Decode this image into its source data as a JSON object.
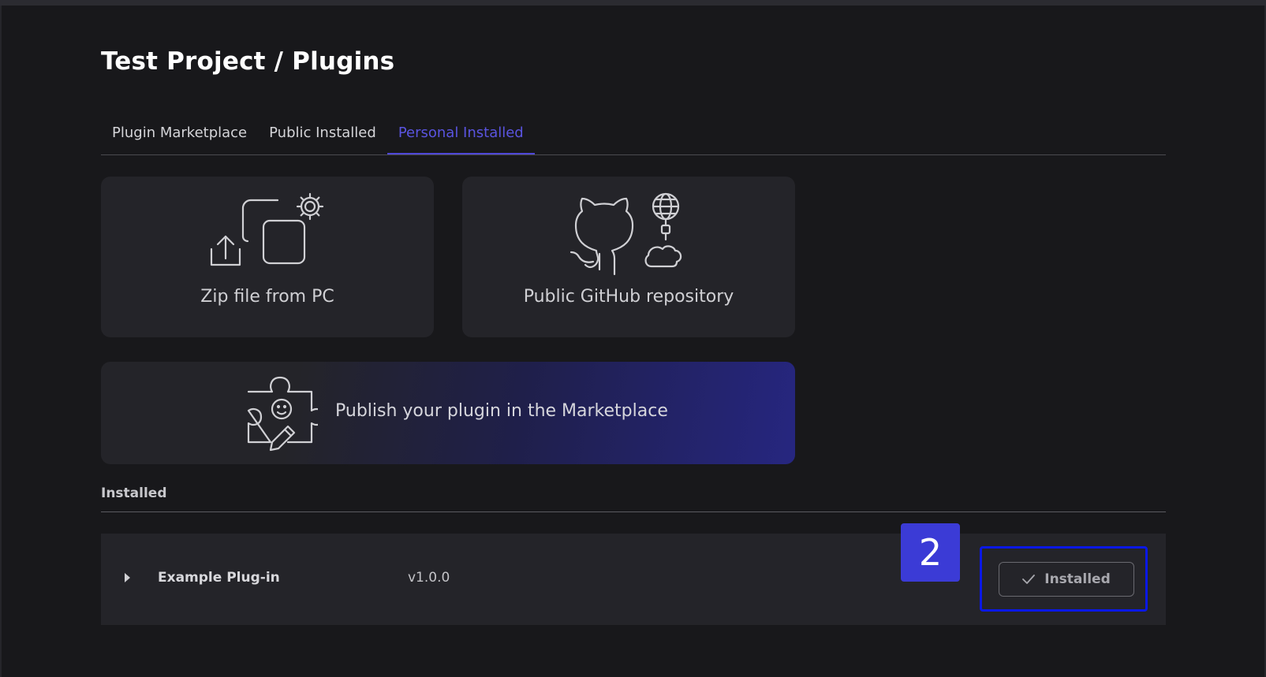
{
  "page": {
    "title": "Test Project / Plugins"
  },
  "tabs": [
    {
      "label": "Plugin Marketplace",
      "active": false
    },
    {
      "label": "Public Installed",
      "active": false
    },
    {
      "label": "Personal Installed",
      "active": true
    }
  ],
  "sources": [
    {
      "label": "Zip file from PC",
      "icon": "upload-zip-icon"
    },
    {
      "label": "Public GitHub repository",
      "icon": "github-icon"
    }
  ],
  "publish": {
    "label": "Publish your plugin in the Marketplace",
    "icon": "puzzle-piece-icon"
  },
  "installed_section": {
    "heading": "Installed",
    "plugins": [
      {
        "name": "Example Plug-in",
        "version": "v1.0.0",
        "status_label": "Installed",
        "status_icon": "check-icon"
      }
    ]
  },
  "annotation": {
    "marker": "2"
  },
  "colors": {
    "background": "#18181b",
    "card": "#242429",
    "accent": "#5a54e0",
    "marker": "#3b3bd6",
    "highlight": "#0a18e6"
  }
}
